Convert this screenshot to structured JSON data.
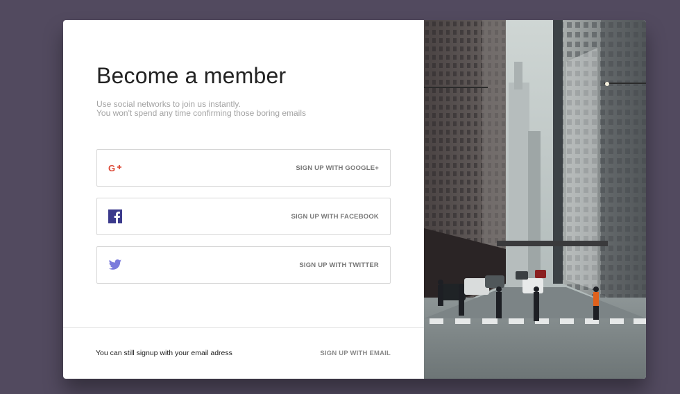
{
  "signup": {
    "title": "Become a member",
    "subtitle_line1": "Use social networks to join us instantly.",
    "subtitle_line2": "You won't spend any time confirming those boring emails",
    "google_label": "SIGN UP WITH GOOGLE+",
    "facebook_label": "SIGN UP WITH FACEBOOK",
    "twitter_label": "SIGN UP WITH TWITTER",
    "footer_text": "You can still signup with your email adress",
    "email_label": "SIGN UP WITH EMAIL"
  },
  "icons": {
    "google": "google-plus-icon",
    "facebook": "facebook-icon",
    "twitter": "twitter-icon"
  },
  "colors": {
    "background": "#524a5f",
    "google": "#dd4b39",
    "facebook": "#3b3a8c",
    "twitter": "#7b7bdc"
  }
}
